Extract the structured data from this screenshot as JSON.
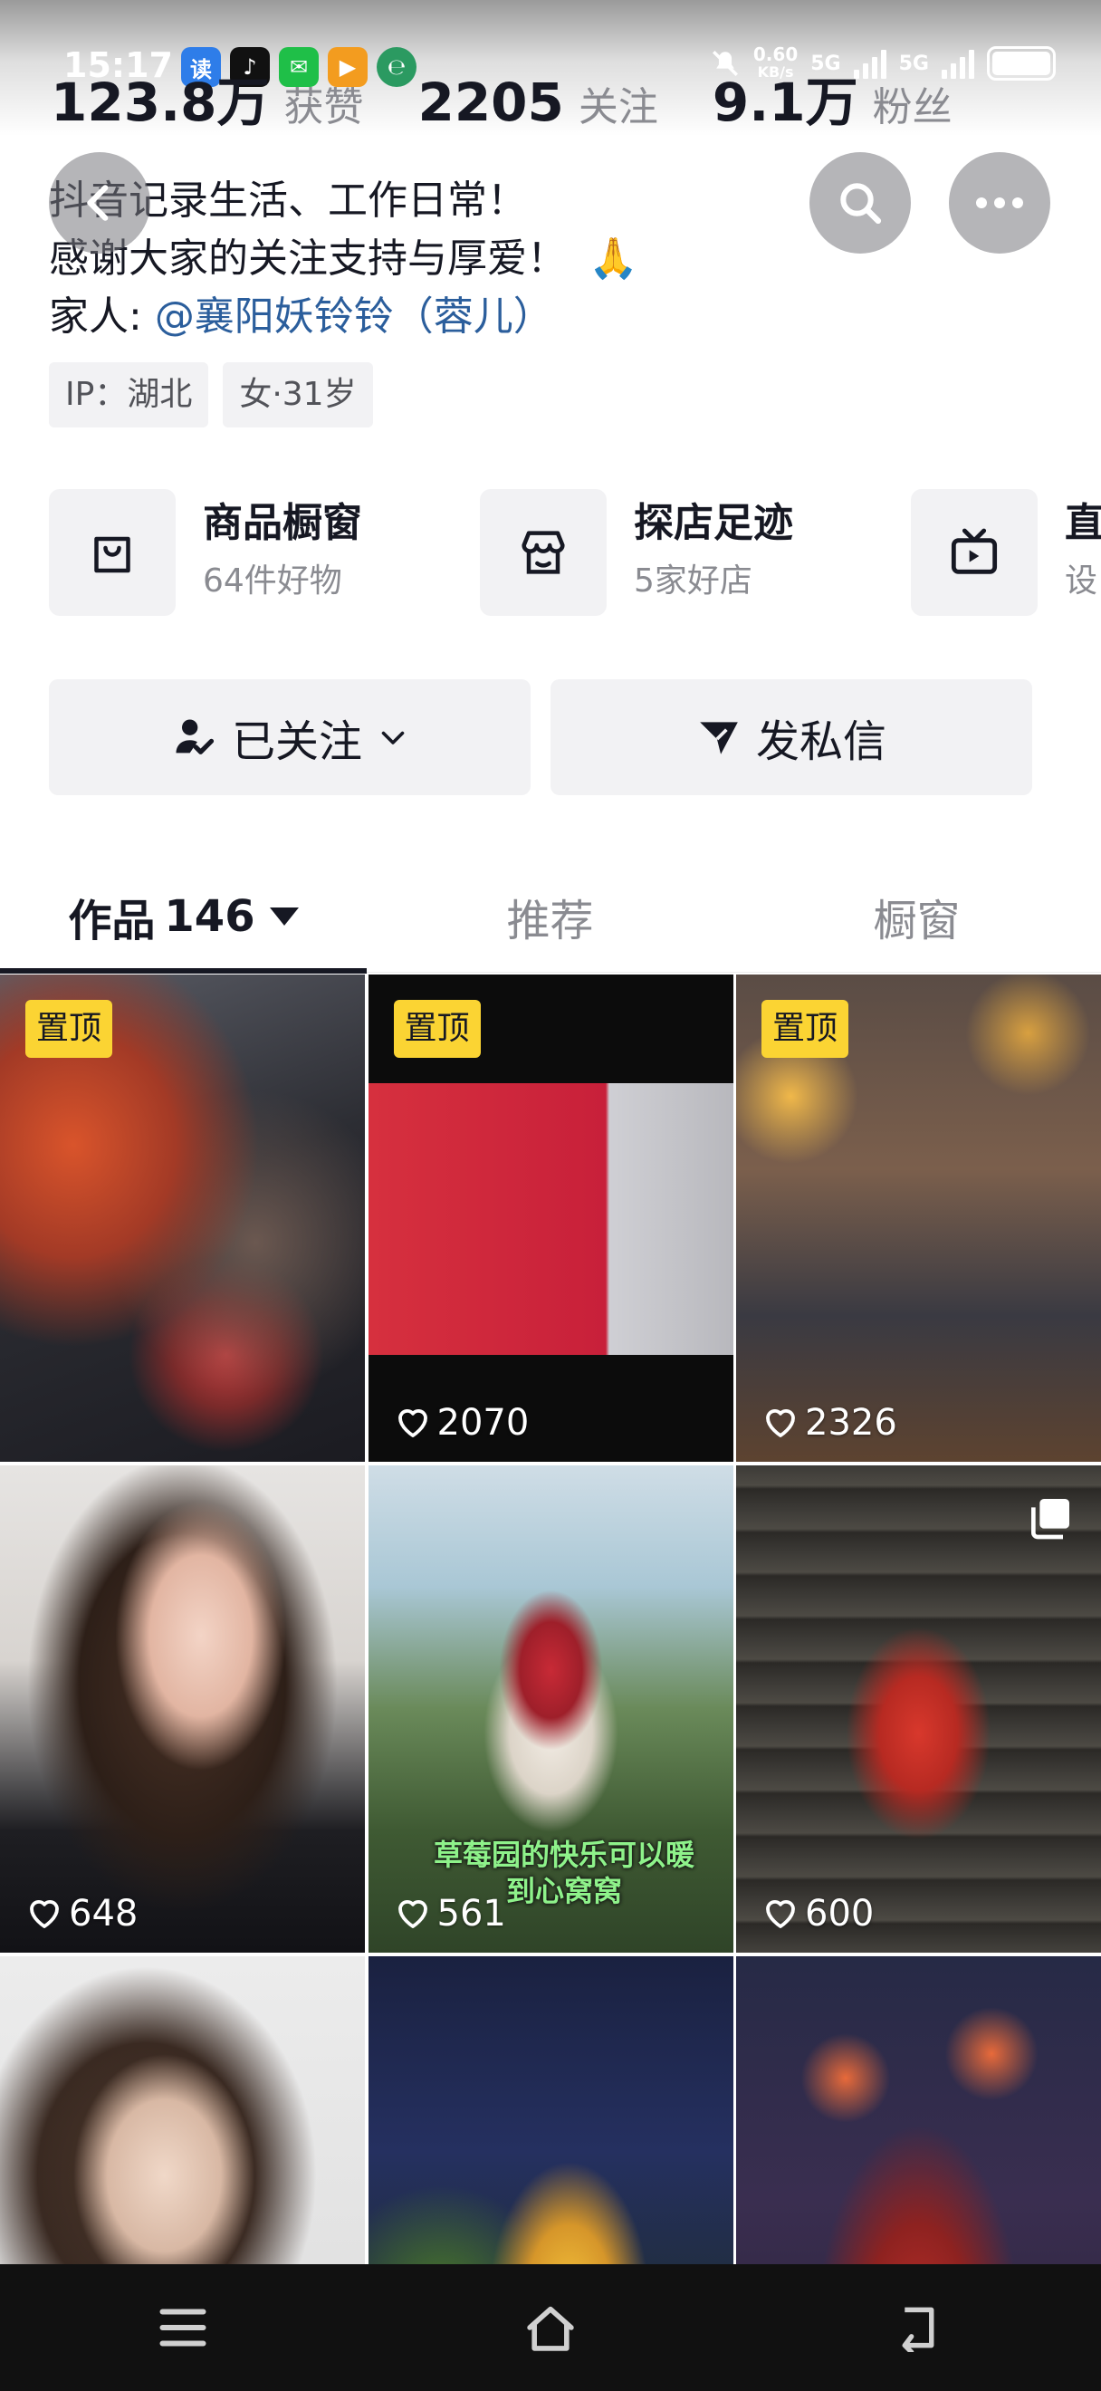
{
  "status_bar": {
    "time": "15:17",
    "apps": [
      "读",
      "♪",
      "✉",
      "▶",
      "℮"
    ],
    "net_speed": "0.60",
    "net_unit": "KB/s",
    "signal_1": "5G",
    "signal_2": "5G"
  },
  "stats": [
    {
      "value": "123.8万",
      "label": "获赞"
    },
    {
      "value": "2205",
      "label": "关注"
    },
    {
      "value": "9.1万",
      "label": "粉丝"
    }
  ],
  "bio": {
    "line1": "抖音记录生活、工作日常！",
    "line2": "感谢大家的关注支持与厚爱！",
    "line2_emoji": "🙏",
    "family_prefix": "家人: ",
    "family_mention": "@襄阳妖铃铃（蓉儿）"
  },
  "tags": [
    "IP：湖北",
    "女·31岁"
  ],
  "services": [
    {
      "title": "商品橱窗",
      "subtitle": "64件好物",
      "icon": "bag-icon"
    },
    {
      "title": "探店足迹",
      "subtitle": "5家好店",
      "icon": "shop-icon"
    },
    {
      "title": "直",
      "subtitle": "设",
      "icon": "tv-icon"
    }
  ],
  "actions": {
    "follow_label": "已关注",
    "message_label": "发私信"
  },
  "tabs": {
    "works_label": "作品",
    "works_count": "146",
    "recommend_label": "推荐",
    "showcase_label": "橱窗"
  },
  "pinned_label": "置顶",
  "videos": [
    {
      "pinned": true,
      "likes": ""
    },
    {
      "pinned": true,
      "likes": "2070"
    },
    {
      "pinned": true,
      "likes": "2326"
    },
    {
      "pinned": false,
      "likes": "648"
    },
    {
      "pinned": false,
      "likes": "561",
      "caption": "草莓园的快乐可以暖到心窝窝"
    },
    {
      "pinned": false,
      "likes": "600"
    },
    {
      "pinned": false,
      "likes": ""
    },
    {
      "pinned": false,
      "likes": ""
    },
    {
      "pinned": false,
      "likes": ""
    }
  ],
  "colors": {
    "pin_bg": "#fbd433",
    "mention": "#2b5e9c",
    "text_primary": "#161823",
    "text_secondary": "#8a8b91"
  }
}
